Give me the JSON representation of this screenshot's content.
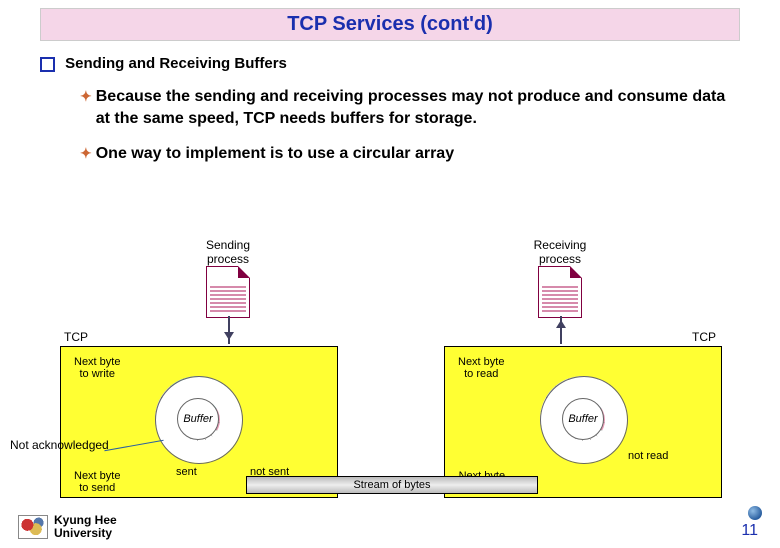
{
  "title": "TCP Services (cont'd)",
  "heading": "Sending and Receiving Buffers",
  "bullets": [
    "Because the sending and receiving processes may not produce and consume data at the same speed, TCP needs buffers for storage.",
    "One way to implement is to use a circular array"
  ],
  "figure": {
    "tcpLeft": "TCP",
    "tcpRight": "TCP",
    "sendingProc": "Sending\nprocess",
    "receivingProc": "Receiving\nprocess",
    "left": {
      "top": "Next byte\nto write",
      "bottom": "Next byte\nto send",
      "buffer": "Buffer",
      "legend1": "sent",
      "legend2": "not sent"
    },
    "right": {
      "top": "Next byte\nto read",
      "bottom": "Next byte\nto receive",
      "buffer": "Buffer",
      "legend": "not read"
    },
    "stream": "Stream of bytes",
    "callout": "Not acknowledged"
  },
  "footer": {
    "university": "Kyung Hee\nUniversity",
    "page": "11"
  }
}
